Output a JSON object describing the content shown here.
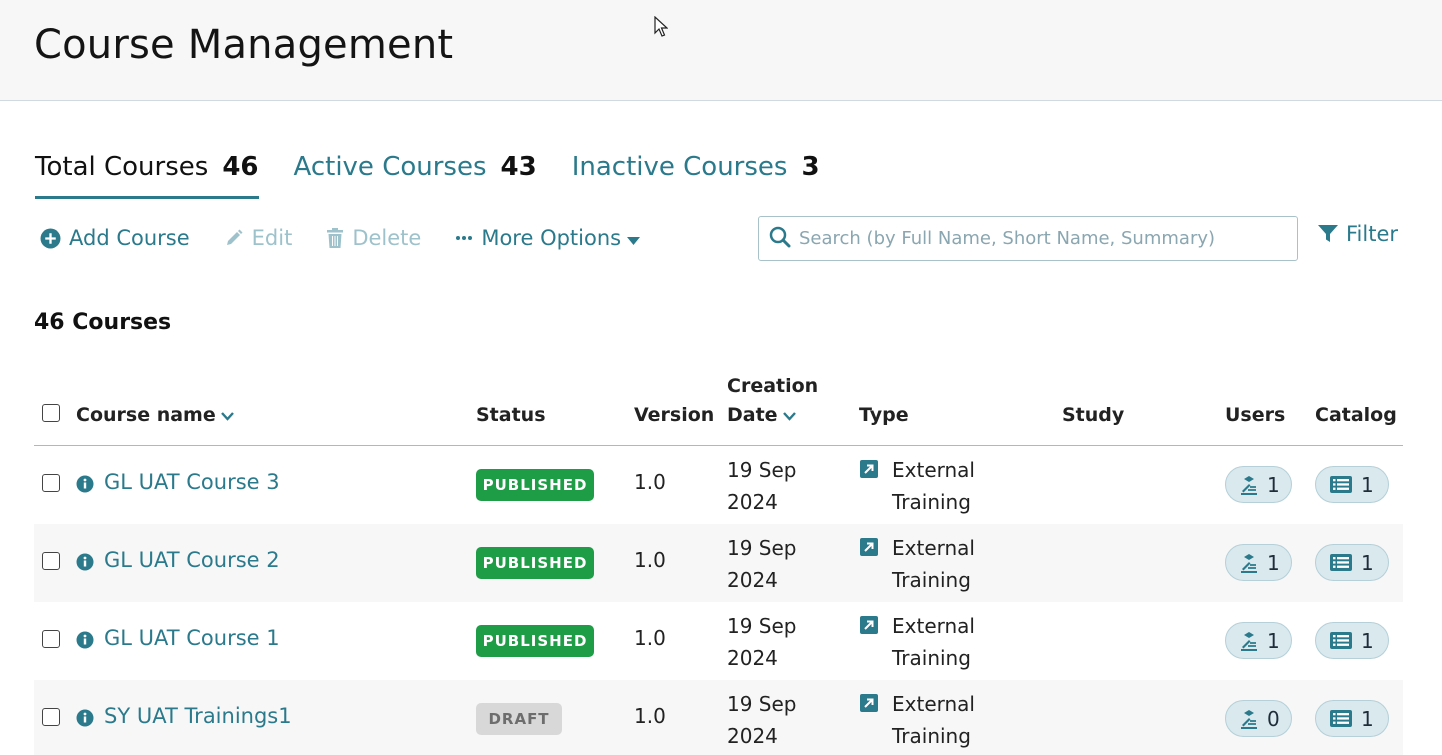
{
  "page": {
    "title": "Course Management"
  },
  "tabs": [
    {
      "label": "Total Courses",
      "count": "46",
      "active": true
    },
    {
      "label": "Active Courses",
      "count": "43",
      "active": false
    },
    {
      "label": "Inactive Courses",
      "count": "3",
      "active": false
    }
  ],
  "toolbar": {
    "add_label": "Add Course",
    "edit_label": "Edit",
    "delete_label": "Delete",
    "more_label": "More Options"
  },
  "search": {
    "placeholder": "Search (by Full Name, Short Name, Summary)"
  },
  "filter": {
    "label": "Filter"
  },
  "list": {
    "count_title": "46 Courses"
  },
  "table": {
    "headers": {
      "course_name": "Course name",
      "status": "Status",
      "version": "Version",
      "creation_line1": "Creation",
      "creation_line2": "Date",
      "type": "Type",
      "study": "Study",
      "users": "Users",
      "catalog": "Catalog"
    },
    "rows": [
      {
        "name": "GL UAT Course 3",
        "status": "PUBLISHED",
        "version": "1.0",
        "date_line1": "19 Sep",
        "date_line2": "2024",
        "type_line1": "External",
        "type_line2": "Training",
        "users": "1",
        "catalog": "1"
      },
      {
        "name": "GL UAT Course 2",
        "status": "PUBLISHED",
        "version": "1.0",
        "date_line1": "19 Sep",
        "date_line2": "2024",
        "type_line1": "External",
        "type_line2": "Training",
        "users": "1",
        "catalog": "1"
      },
      {
        "name": "GL UAT Course 1",
        "status": "PUBLISHED",
        "version": "1.0",
        "date_line1": "19 Sep",
        "date_line2": "2024",
        "type_line1": "External",
        "type_line2": "Training",
        "users": "1",
        "catalog": "1"
      },
      {
        "name": "SY UAT Trainings1",
        "status": "DRAFT",
        "version": "1.0",
        "date_line1": "19 Sep",
        "date_line2": "2024",
        "type_line1": "External",
        "type_line2": "Training",
        "users": "0",
        "catalog": "1"
      }
    ]
  },
  "colors": {
    "accent": "#2b7a8c",
    "published": "#1f9c46",
    "draft": "#d8d8d8",
    "pill": "#d9e9ee"
  }
}
